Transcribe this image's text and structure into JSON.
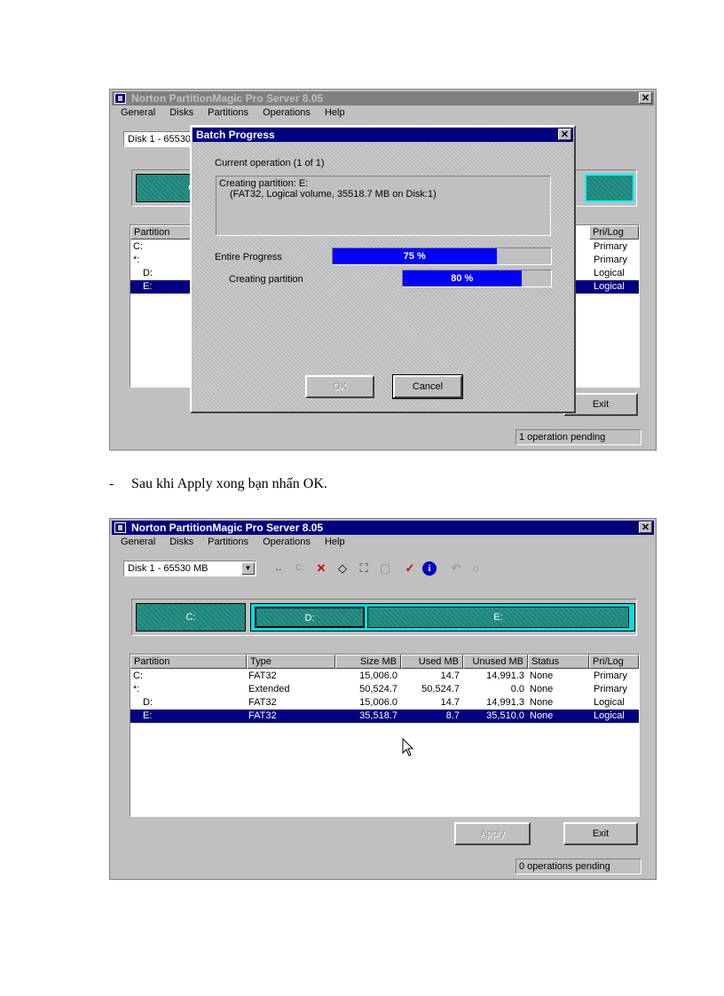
{
  "app": {
    "title": "Norton PartitionMagic Pro Server 8.05",
    "menu": [
      "General",
      "Disks",
      "Partitions",
      "Operations",
      "Help"
    ],
    "close_glyph": "✕"
  },
  "screen1": {
    "disk_combo_partial": "Disk 1 - 65530",
    "seg_c_partial": "C",
    "list_headers_visible": [
      "Partition",
      "Pri/Log"
    ],
    "partitions_left": [
      "C:",
      "*:",
      "D:",
      "E:"
    ],
    "pri_log": [
      "Primary",
      "Primary",
      "Logical",
      "Logical"
    ],
    "selected_index": 3,
    "exit_label": "Exit",
    "status": "1 operation pending",
    "dialog": {
      "title": "Batch Progress",
      "current_operation": "Current operation (1 of 1)",
      "detail_line1": "Creating partition: E:",
      "detail_line2": "(FAT32, Logical volume, 35518.7 MB on Disk:1)",
      "entire_progress_label": "Entire Progress",
      "entire_progress_percent": 75,
      "entire_progress_text": "75 %",
      "creating_partition_label": "Creating partition",
      "creating_partition_percent": 80,
      "creating_partition_text": "80 %",
      "ok_label": "OK",
      "cancel_label": "Cancel"
    }
  },
  "caption": {
    "bullet": "-",
    "text": "Sau khi Apply xong bạn nhấn OK."
  },
  "screen2": {
    "disk_combo": "Disk 1 - 65530  MB",
    "toolbar_icons": [
      "resize-move-icon",
      "copy-partition-icon",
      "delete-icon",
      "label-icon",
      "resize-icon",
      "properties-icon",
      "apply-check-icon",
      "info-icon",
      "undo-icon",
      "cancel-icon"
    ],
    "disk_map": {
      "c_label": "C:",
      "d_label": "D:",
      "e_label": "E:"
    },
    "columns": [
      "Partition",
      "Type",
      "Size MB",
      "Used MB",
      "Unused MB",
      "Status",
      "Pri/Log"
    ],
    "rows": [
      {
        "partition": "C:",
        "type": "FAT32",
        "size": "15,006.0",
        "used": "14.7",
        "unused": "14,991.3",
        "status": "None",
        "prilog": "Primary"
      },
      {
        "partition": "*:",
        "type": "Extended",
        "size": "50,524.7",
        "used": "50,524.7",
        "unused": "0.0",
        "status": "None",
        "prilog": "Primary"
      },
      {
        "partition": "D:",
        "type": "FAT32",
        "size": "15,006.0",
        "used": "14.7",
        "unused": "14,991.3",
        "status": "None",
        "prilog": "Logical"
      },
      {
        "partition": "E:",
        "type": "FAT32",
        "size": "35,518.7",
        "used": "8.7",
        "unused": "35,510.0",
        "status": "None",
        "prilog": "Logical"
      }
    ],
    "selected_index": 3,
    "apply_label": "Apply",
    "exit_label": "Exit",
    "status": "0 operations pending"
  },
  "colors": {
    "titlebar": "#000080",
    "partition_fill": "#1f8a80",
    "selection": "#000080",
    "progress_fill": "#0000ff"
  }
}
